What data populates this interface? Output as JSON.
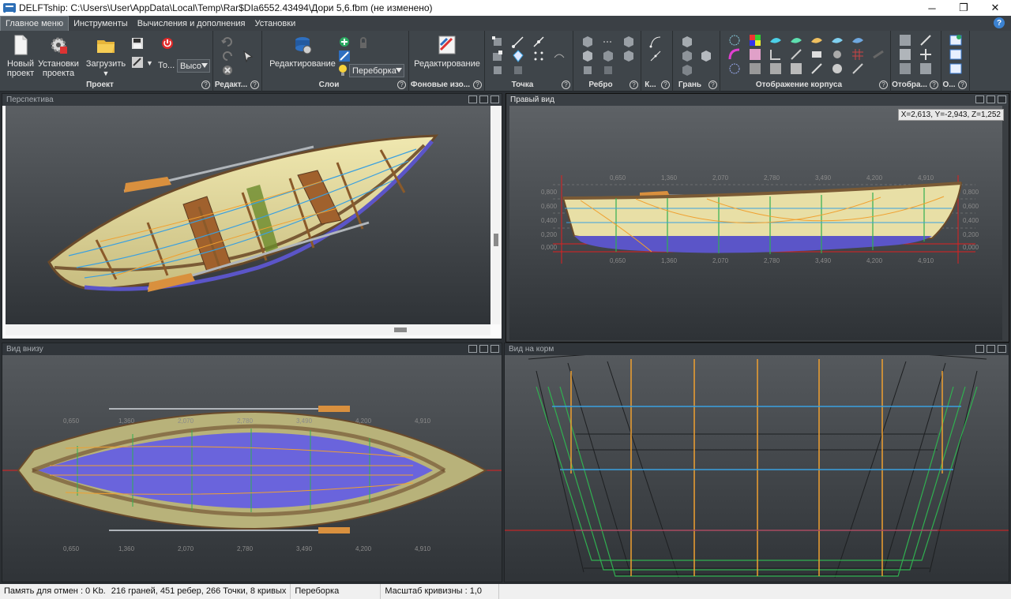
{
  "window": {
    "title": "DELFTship: C:\\Users\\User\\AppData\\Local\\Temp\\Rar$DIa6552.43494\\Дори 5,6.fbm (не изменено)",
    "minimize": "─",
    "maximize": "❐",
    "close": "✕"
  },
  "tabs": [
    {
      "label": "Главное меню",
      "active": true
    },
    {
      "label": "Инструменты",
      "active": false
    },
    {
      "label": "Вычисления и дополнения",
      "active": false
    },
    {
      "label": "Установки",
      "active": false
    }
  ],
  "ribbon": {
    "project": {
      "label": "Проект",
      "new_project": "Новый проект",
      "project_settings": "Установки проекта",
      "load": "Загрузить",
      "to_label": "То...",
      "quality_combo": "Высо"
    },
    "edit_group": {
      "label": "Редакт..."
    },
    "layers": {
      "label": "Слои",
      "edit": "Редактирование",
      "combo": "Переборка"
    },
    "background": {
      "label": "Фоновые изо...",
      "edit": "Редактирование"
    },
    "point": {
      "label": "Точка"
    },
    "edge": {
      "label": "Ребро"
    },
    "curve": {
      "label": "К..."
    },
    "face": {
      "label": "Грань"
    },
    "hull_display": {
      "label": "Отображение корпуса"
    },
    "display": {
      "label": "Отобра..."
    },
    "other": {
      "label": "О..."
    }
  },
  "viewports": {
    "perspective": {
      "title": "Перспектива"
    },
    "right": {
      "title": "Правый вид",
      "coords": "X=2,613, Y=-2,943, Z=1,252"
    },
    "bottom": {
      "title": "Вид внизу"
    },
    "stern": {
      "title": "Вид на корм"
    }
  },
  "right_view_axis": {
    "x_ticks": [
      "0,650",
      "1,360",
      "2,070",
      "2,780",
      "3,490",
      "4,200",
      "4,910"
    ],
    "z_ticks": [
      "0,800",
      "0,600",
      "0,400",
      "0,200",
      "0,000"
    ]
  },
  "bottom_view_axis": {
    "x_ticks_top": [
      "0,650",
      "1,360",
      "2,070",
      "2,780",
      "3,490",
      "4,200",
      "4,910"
    ],
    "x_ticks_bottom": [
      "0,650",
      "1,360",
      "2,070",
      "2,780",
      "3,490",
      "4,200",
      "4,910"
    ]
  },
  "status": {
    "memory": "Память для отмен : 0 Kb.",
    "geometry": "216 граней, 451 ребер, 266 Точки, 8 кривых",
    "layer": "Переборка",
    "curvature": "Масштаб кривизны : 1,0"
  },
  "colors": {
    "background": "#2b2f33",
    "hull_fill": "#e8dfa6",
    "bottom_fill": "#5b55c8",
    "frame_orange": "#f0a030",
    "waterline_blue": "#3aa0e0",
    "station_green": "#30b050",
    "red_axis": "#e02020"
  }
}
